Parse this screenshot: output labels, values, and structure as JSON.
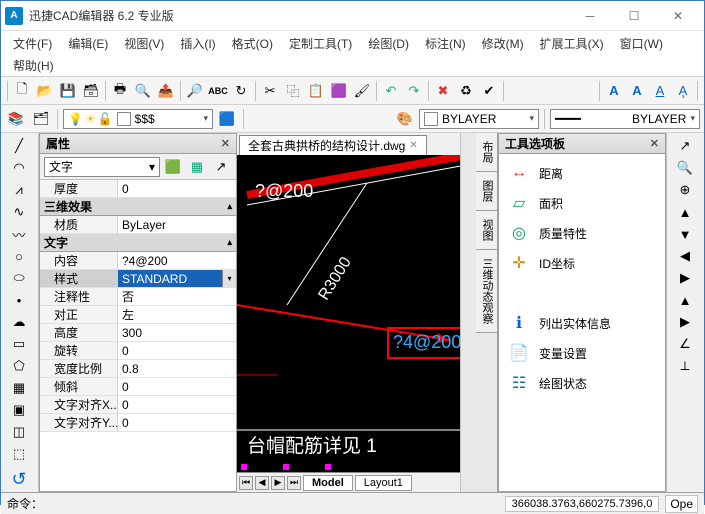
{
  "titlebar": {
    "app_name": "迅捷CAD编辑器 6.2 专业版"
  },
  "menu": {
    "file": "文件(F)",
    "edit": "编辑(E)",
    "view": "视图(V)",
    "insert": "插入(I)",
    "format": "格式(O)",
    "custom": "定制工具(T)",
    "draw": "绘图(D)",
    "annotate": "标注(N)",
    "modify": "修改(M)",
    "ext": "扩展工具(X)",
    "window": "窗口(W)",
    "help": "帮助(H)"
  },
  "layer_dropdown": "$$$",
  "bylayer1": "BYLAYER",
  "bylayer2": "BYLAYER",
  "props_panel": {
    "title": "属性",
    "selector": "文字",
    "rows": {
      "thickness_k": "厚度",
      "thickness_v": "0",
      "cat_3d": "三维效果",
      "material_k": "材质",
      "material_v": "ByLayer",
      "cat_text": "文字",
      "content_k": "内容",
      "content_v": "?4@200",
      "style_k": "样式",
      "style_v": "STANDARD",
      "annot_k": "注释性",
      "annot_v": "否",
      "align_k": "对正",
      "align_v": "左",
      "height_k": "高度",
      "height_v": "300",
      "rotate_k": "旋转",
      "rotate_v": "0",
      "wratio_k": "宽度比例",
      "wratio_v": "0.8",
      "slant_k": "倾斜",
      "slant_v": "0",
      "txax_k": "文字对齐X...",
      "txax_v": "0",
      "txay_k": "文字对齐Y...",
      "txay_v": "0"
    }
  },
  "tab_name": "全套古典拱桥的结构设计.dwg",
  "canvas": {
    "t1": "?@200",
    "t2": "R3000",
    "t3": "?4@200",
    "caption": "台帽配筋详见 1"
  },
  "bottom_tabs": {
    "model": "Model",
    "layout": "Layout1"
  },
  "side_tabs": {
    "t1": "布局",
    "t2": "图层",
    "t3": "视图",
    "t4": "三维动态观察"
  },
  "right_panel": {
    "title": "工具选项板",
    "items": {
      "dist": "距离",
      "area": "面积",
      "mass": "质量特性",
      "idpt": "ID坐标",
      "list": "列出实体信息",
      "var": "变量设置",
      "dstat": "绘图状态"
    }
  },
  "status": {
    "cmd": "命令：",
    "coords": "366038.3763,660275.7396,0",
    "mode": "Ope"
  }
}
